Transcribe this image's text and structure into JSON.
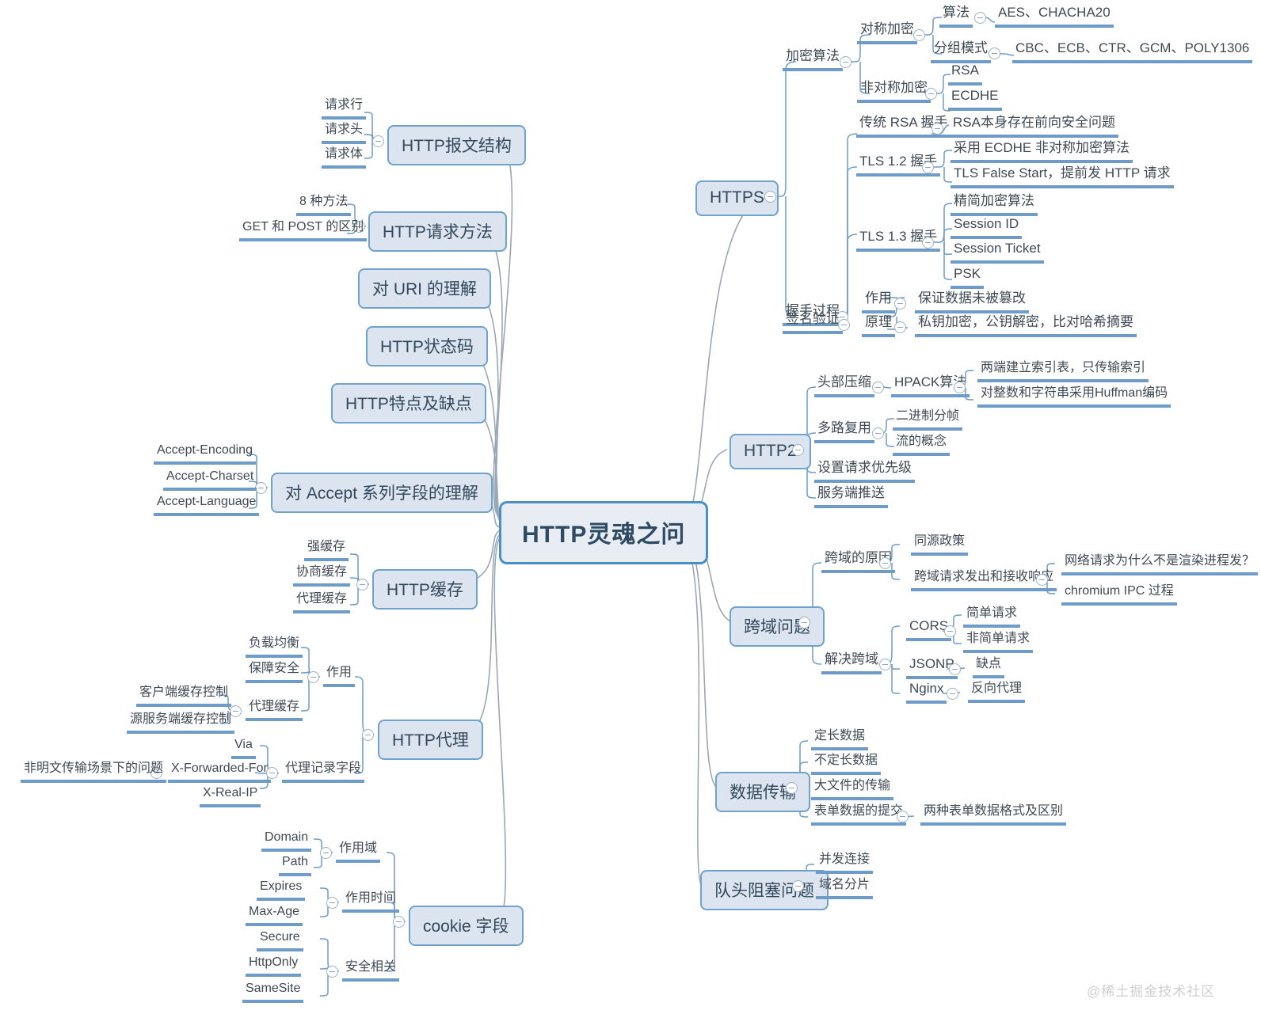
{
  "root": {
    "label": "HTTP灵魂之问"
  },
  "watermark": {
    "text": "@稀土掘金技术社区"
  },
  "branches": {
    "https": {
      "label": "HTTPS",
      "children": [
        {
          "label": "加密算法",
          "children": [
            {
              "label": "对称加密",
              "children": [
                {
                  "label": "算法",
                  "children": [
                    {
                      "label": "AES、CHACHA20"
                    }
                  ]
                },
                {
                  "label": "分组模式",
                  "children": [
                    {
                      "label": "CBC、ECB、CTR、GCM、POLY1306"
                    }
                  ]
                }
              ]
            },
            {
              "label": "非对称加密",
              "children": [
                {
                  "label": "RSA"
                },
                {
                  "label": "ECDHE"
                }
              ]
            }
          ]
        },
        {
          "label": "握手过程",
          "children": [
            {
              "label": "传统 RSA 握手",
              "children": [
                {
                  "label": "RSA本身存在前向安全问题"
                }
              ]
            },
            {
              "label": "TLS 1.2 握手",
              "children": [
                {
                  "label": "采用 ECDHE 非对称加密算法"
                },
                {
                  "label": "TLS False Start，提前发 HTTP 请求"
                }
              ]
            },
            {
              "label": "TLS 1.3 握手",
              "children": [
                {
                  "label": "精简加密算法"
                },
                {
                  "label": "Session ID"
                },
                {
                  "label": "Session Ticket"
                },
                {
                  "label": "PSK"
                }
              ]
            }
          ]
        },
        {
          "label": "签名验证",
          "children": [
            {
              "label": "作用",
              "children": [
                {
                  "label": "保证数据未被篡改"
                }
              ]
            },
            {
              "label": "原理",
              "children": [
                {
                  "label": "私钥加密，公钥解密，比对哈希摘要"
                }
              ]
            }
          ]
        }
      ]
    },
    "http2": {
      "label": "HTTP2",
      "children": [
        {
          "label": "头部压缩",
          "children": [
            {
              "label": "HPACK算法",
              "children": [
                {
                  "label": "两端建立索引表，只传输索引"
                },
                {
                  "label": "对整数和字符串采用Huffman编码"
                }
              ]
            }
          ]
        },
        {
          "label": "多路复用",
          "children": [
            {
              "label": "二进制分帧"
            },
            {
              "label": "流的概念"
            }
          ]
        },
        {
          "label": "设置请求优先级"
        },
        {
          "label": "服务端推送"
        }
      ]
    },
    "crossdomain": {
      "label": "跨域问题",
      "children": [
        {
          "label": "跨域的原因",
          "children": [
            {
              "label": "同源政策"
            },
            {
              "label": "跨域请求发出和接收响应",
              "children": [
                {
                  "label": "网络请求为什么不是渲染进程发？"
                },
                {
                  "label": "chromium IPC 过程"
                }
              ]
            }
          ]
        },
        {
          "label": "解决跨域",
          "children": [
            {
              "label": "CORS",
              "children": [
                {
                  "label": "简单请求"
                },
                {
                  "label": "非简单请求"
                }
              ]
            },
            {
              "label": "JSONP",
              "children": [
                {
                  "label": "缺点"
                }
              ]
            },
            {
              "label": "Nginx",
              "children": [
                {
                  "label": "反向代理"
                }
              ]
            }
          ]
        }
      ]
    },
    "datatransfer": {
      "label": "数据传输",
      "children": [
        {
          "label": "定长数据"
        },
        {
          "label": "不定长数据"
        },
        {
          "label": "大文件的传输"
        },
        {
          "label": "表单数据的提交",
          "children": [
            {
              "label": "两种表单数据格式及区别"
            }
          ]
        }
      ]
    },
    "headofline": {
      "label": "队头阻塞问题",
      "children": [
        {
          "label": "并发连接"
        },
        {
          "label": "域名分片"
        }
      ]
    },
    "message_structure": {
      "label": "HTTP报文结构",
      "children": [
        {
          "label": "请求行"
        },
        {
          "label": "请求头"
        },
        {
          "label": "请求体"
        }
      ]
    },
    "request_methods": {
      "label": "HTTP请求方法",
      "children": [
        {
          "label": "8 种方法"
        },
        {
          "label": "GET 和 POST 的区别"
        }
      ]
    },
    "uri": {
      "label": "对 URI 的理解",
      "children": []
    },
    "status_code": {
      "label": "HTTP状态码",
      "children": []
    },
    "features": {
      "label": "HTTP特点及缺点",
      "children": []
    },
    "accept_fields": {
      "label": "对 Accept 系列字段的理解",
      "children": [
        {
          "label": "Accept-Encoding"
        },
        {
          "label": "Accept-Charset"
        },
        {
          "label": "Accept-Language"
        }
      ]
    },
    "cache": {
      "label": "HTTP缓存",
      "children": [
        {
          "label": "强缓存"
        },
        {
          "label": "协商缓存"
        },
        {
          "label": "代理缓存"
        }
      ]
    },
    "proxy": {
      "label": "HTTP代理",
      "children": [
        {
          "label": "作用",
          "children": [
            {
              "label": "负载均衡"
            },
            {
              "label": "保障安全"
            },
            {
              "label": "代理缓存",
              "children": [
                {
                  "label": "客户端缓存控制"
                },
                {
                  "label": "源服务端缓存控制"
                }
              ]
            }
          ]
        },
        {
          "label": "代理记录字段",
          "children": [
            {
              "label": "Via"
            },
            {
              "label": "X-Forwarded-For",
              "children": [
                {
                  "label": "非明文传输场景下的问题"
                }
              ]
            },
            {
              "label": "X-Real-IP"
            }
          ]
        }
      ]
    },
    "cookie": {
      "label": "cookie 字段",
      "children": [
        {
          "label": "作用域",
          "children": [
            {
              "label": "Domain"
            },
            {
              "label": "Path"
            }
          ]
        },
        {
          "label": "作用时间",
          "children": [
            {
              "label": "Expires"
            },
            {
              "label": "Max-Age"
            }
          ]
        },
        {
          "label": "安全相关",
          "children": [
            {
              "label": "Secure"
            },
            {
              "label": "HttpOnly"
            },
            {
              "label": "SameSite"
            }
          ]
        }
      ]
    }
  },
  "colors": {
    "node_fill": "#dce5ef",
    "node_border": "#6fa2cd",
    "root_border": "#4a8fc7",
    "leaf_underline": "#6f9bc8",
    "wire": "#9aa8b4",
    "text": "#3a4a5a"
  }
}
